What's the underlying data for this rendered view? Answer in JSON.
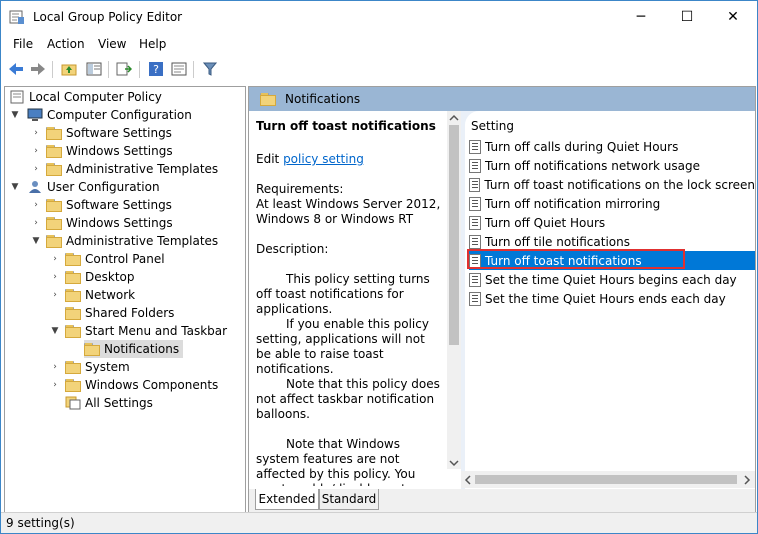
{
  "window": {
    "title": "Local Group Policy Editor",
    "controls": {
      "minimize": "─",
      "maximize": "☐",
      "close": "✕"
    }
  },
  "menu": [
    "File",
    "Action",
    "View",
    "Help"
  ],
  "toolbar": {
    "icons": [
      "back-icon",
      "forward-icon",
      "up-folder-icon",
      "show-hide-tree-icon",
      "export-list-icon",
      "help-icon",
      "properties-icon",
      "filter-icon"
    ]
  },
  "tree": {
    "root": "Local Computer Policy",
    "items": [
      {
        "label": "Local Computer Policy"
      },
      {
        "label": "Computer Configuration"
      },
      {
        "label": "Software Settings"
      },
      {
        "label": "Windows Settings"
      },
      {
        "label": "Administrative Templates"
      },
      {
        "label": "User Configuration"
      },
      {
        "label": "Software Settings"
      },
      {
        "label": "Windows Settings"
      },
      {
        "label": "Administrative Templates"
      },
      {
        "label": "Control Panel"
      },
      {
        "label": "Desktop"
      },
      {
        "label": "Network"
      },
      {
        "label": "Shared Folders"
      },
      {
        "label": "Start Menu and Taskbar"
      },
      {
        "label": "Notifications"
      },
      {
        "label": "System"
      },
      {
        "label": "Windows Components"
      },
      {
        "label": "All Settings"
      }
    ]
  },
  "right_pane": {
    "header": "Notifications",
    "description": {
      "title": "Turn off toast notifications",
      "edit_prefix": "Edit ",
      "edit_link": "policy setting",
      "requirements_label": "Requirements:",
      "requirements_text": "At least Windows Server 2012, Windows 8 or Windows RT",
      "description_label": "Description:",
      "para1": "This policy setting turns off toast notifications for applications.",
      "para2": "If you enable this policy setting, applications will not be able to raise toast notifications.",
      "para3": "Note that this policy does not affect taskbar notification balloons.",
      "para4": "Note that Windows system features are not affected by this policy.  You must enable/disable system features individually to"
    },
    "list_header": "Setting",
    "settings": [
      "Turn off calls during Quiet Hours",
      "Turn off notifications network usage",
      "Turn off toast notifications on the lock screen",
      "Turn off notification mirroring",
      "Turn off Quiet Hours",
      "Turn off tile notifications",
      "Turn off toast notifications",
      "Set the time Quiet Hours begins each day",
      "Set the time Quiet Hours ends each day"
    ],
    "selected_setting": "Turn off toast notifications",
    "tabs": [
      "Extended",
      "Standard"
    ],
    "active_tab": "Extended"
  },
  "status": "9 setting(s)",
  "colors": {
    "header_bg": "#9ab6d4",
    "selection": "#0078d7",
    "highlight_box": "#e03030",
    "link": "#0066cc"
  }
}
